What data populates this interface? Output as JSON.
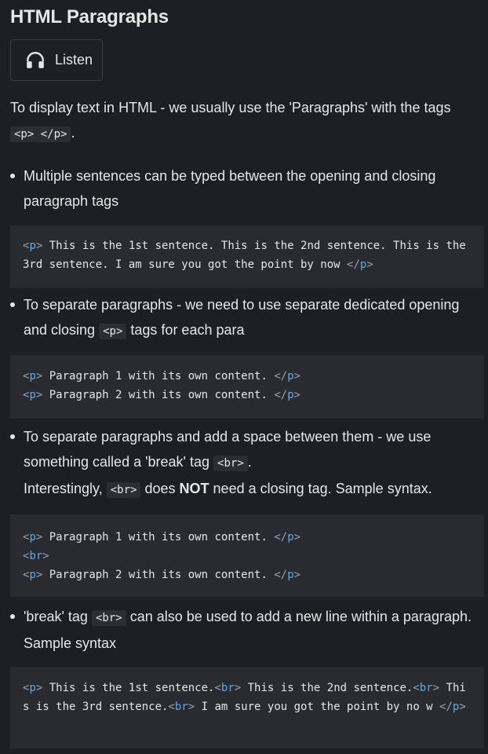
{
  "title": "HTML Paragraphs",
  "listen": {
    "label": "Listen",
    "icon": "headphones-icon"
  },
  "intro": {
    "text": "To display text in HTML - we usually use the 'Paragraphs' with the tags",
    "code": "<p> </p>",
    "suffix": "."
  },
  "bullets": [
    {
      "text": "Multiple sentences can be typed between the opening and closing paragraph tags",
      "code": "<p> This is the 1st sentence. This is the 2nd sentence. This is the 3rd sentence. I am sure you got the point by now </p>"
    },
    {
      "text_before": "To separate paragraphs - we need to use separate dedicated opening and closing",
      "inline_code": "<p>",
      "text_after": "tags for each para",
      "code_lines": [
        "<p> Paragraph 1 with its own content. </p>",
        "<p> Paragraph 2 with its own content. </p>"
      ]
    },
    {
      "text_before": "To separate paragraphs and add a space between them - we use something called a 'break' tag",
      "inline_code": "<br>",
      "text_after": ".",
      "line2_before": "Interestingly,",
      "line2_code": "<br>",
      "line2_mid": "does",
      "line2_bold": "NOT",
      "line2_after": "need a closing tag. Sample syntax.",
      "code_lines": [
        "<p> Paragraph 1 with its own content. </p>",
        "<br>",
        "<p> Paragraph 2 with its own content. </p>"
      ]
    },
    {
      "text_before": "'break' tag",
      "inline_code": "<br>",
      "text_after": "can also be used to add a new line within a paragraph. Sample syntax",
      "code": "<p> This is the 1st sentence.<br> This is the 2nd sentence.<br> This is the 3rd sentence.<br> I am sure you got the point by no w </p>"
    }
  ]
}
